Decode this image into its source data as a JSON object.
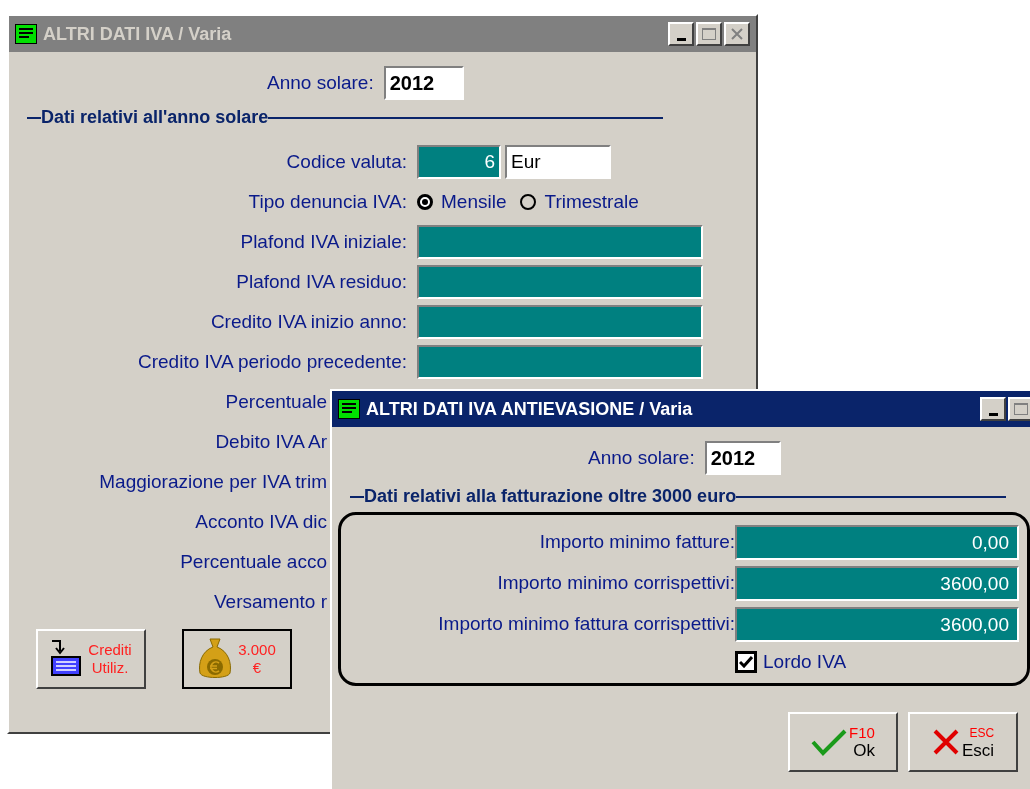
{
  "main_window": {
    "title": "ALTRI DATI IVA / Varia",
    "active": false,
    "year": {
      "label": "Anno solare:",
      "value": "2012"
    },
    "section": "Dati relativi all'anno solare",
    "rows": [
      {
        "kind": "currency",
        "label": "Codice valuta:",
        "code": "6",
        "name": "Eur"
      },
      {
        "kind": "radio",
        "label": "Tipo denuncia IVA:",
        "options": [
          {
            "label": "Mensile",
            "selected": true
          },
          {
            "label": "Trimestrale",
            "selected": false
          }
        ]
      },
      {
        "kind": "field",
        "label": "Plafond IVA iniziale:"
      },
      {
        "kind": "field",
        "label": "Plafond IVA residuo:"
      },
      {
        "kind": "field",
        "label": "Credito IVA inizio anno:"
      },
      {
        "kind": "field",
        "label": "Credito IVA periodo precedente:"
      },
      {
        "kind": "covered",
        "label": "Percentuale"
      },
      {
        "kind": "covered",
        "label": "Debito IVA Ar"
      },
      {
        "kind": "covered",
        "label": "Maggiorazione per IVA trim"
      },
      {
        "kind": "covered",
        "label": "Acconto IVA dic"
      },
      {
        "kind": "covered",
        "label": "Percentuale acco"
      },
      {
        "kind": "covered",
        "label": "Versamento r"
      }
    ],
    "buttons": [
      {
        "kind": "credits",
        "lines": [
          "Crediti",
          "Utiliz."
        ]
      },
      {
        "kind": "money",
        "lines": [
          "3.000",
          "€"
        ]
      }
    ]
  },
  "dialog": {
    "title": "ALTRI DATI IVA ANTIEVASIONE / Varia",
    "active": true,
    "year": {
      "label": "Anno solare:",
      "value": "2012"
    },
    "section": "Dati relativi alla fatturazione oltre 3000 euro",
    "rows": [
      {
        "label": "Importo minimo fatture:",
        "value": "0,00"
      },
      {
        "label": "Importo minimo corrispettivi:",
        "value": "3600,00"
      },
      {
        "label": "Importo minimo fattura corrispettivi:",
        "value": "3600,00"
      }
    ],
    "checkbox": {
      "label": "Lordo IVA",
      "checked": true
    },
    "buttons": [
      {
        "kind": "ok",
        "key": "F10",
        "label": "Ok"
      },
      {
        "kind": "cancel",
        "key": "ESC",
        "label": "Esci"
      }
    ]
  }
}
